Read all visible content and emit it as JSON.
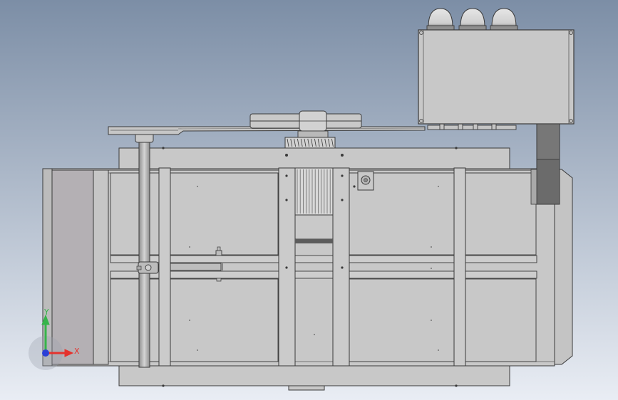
{
  "viewport": {
    "background_top": "#7c8ea6",
    "background_bottom": "#e9edf4"
  },
  "colors": {
    "part_fill": "#c8c8c8",
    "part_fill_dark": "#a3a3a3",
    "part_fill_light": "#dadada",
    "edge": "#3a3a3a",
    "side_panel": "#b4b0b4"
  },
  "triad": {
    "x_label": "X",
    "y_label": "Y",
    "x_color": "#e5322d",
    "y_color": "#36b44a",
    "z_color": "#2b3fd6"
  }
}
